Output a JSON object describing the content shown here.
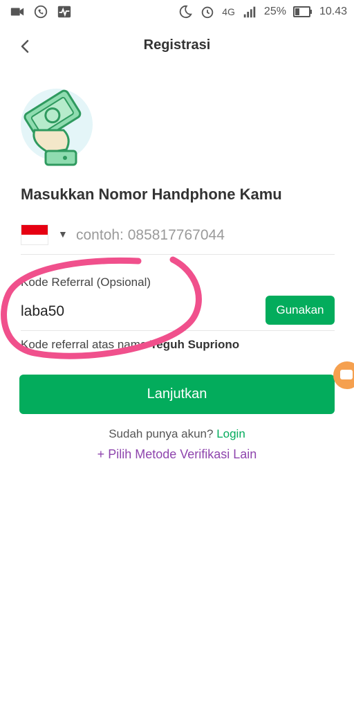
{
  "statusbar": {
    "network": "4G",
    "battery": "25%",
    "time": "10.43"
  },
  "header": {
    "title": "Registrasi",
    "back_icon": "chevron-left-icon"
  },
  "form": {
    "heading": "Masukkan Nomor Handphone Kamu",
    "phone": {
      "placeholder": "contoh: 085817767044",
      "value": ""
    },
    "referral": {
      "label": "Kode Referral (Opsional)",
      "value": "laba50",
      "apply_label": "Gunakan",
      "info_prefix": "Kode referral atas nama",
      "info_name": "Teguh Supriono"
    },
    "submit_label": "Lanjutkan"
  },
  "footer": {
    "has_account": "Sudah punya akun?",
    "login_label": "Login",
    "alt_method_label": "Pilih Metode Verifikasi Lain"
  },
  "colors": {
    "primary": "#03ac5c",
    "link_purple": "#8e44ad",
    "annotation": "#f0508c"
  }
}
